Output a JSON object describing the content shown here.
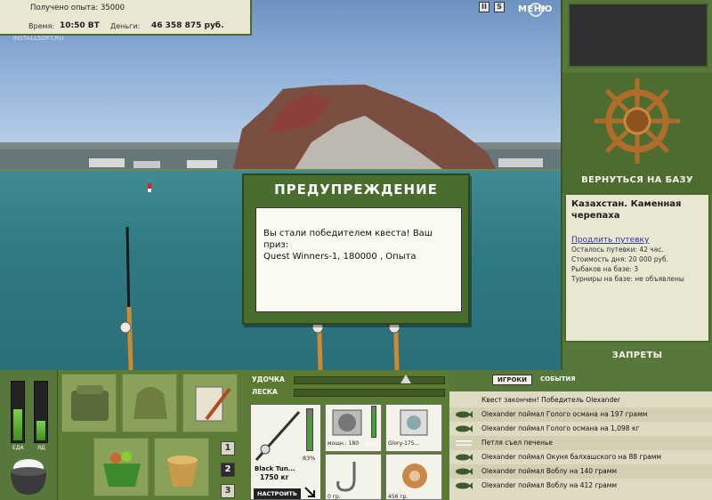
{
  "header": {
    "experience_label": "Получено опыта: 35000",
    "time_label": "Время:",
    "time_value": "10:50 ВТ",
    "money_label": "Деньги:",
    "money_value": "46 358 875 руб.",
    "watermark": "INSTALLSOFT.RU",
    "pause_icon_text": "II",
    "sound_icon_text": "S",
    "menu_label": "МЕНЮ"
  },
  "right_panel": {
    "return_label": "ВЕРНУТЬСЯ НА БАЗУ",
    "place_title": "Казахстан. Каменная черепаха",
    "extend_link": "Продлить путевку",
    "info_lines": [
      "Осталось путевки: 42 час.",
      "Стоимость дня: 20 000 руб.",
      "Рыбаков на базе: 3",
      "Турниры на базе: не объявлены"
    ],
    "bans_label": "ЗАПРЕТЫ"
  },
  "dialog": {
    "title": "ПРЕДУПРЕЖДЕНИЕ",
    "message_line1": "Вы стали победителем квеста! Ваш приз:",
    "message_line2": "Quest Winners-1, 180000 , Опыта"
  },
  "status": {
    "food_label": "ЕДА",
    "poison_label": "ЯД",
    "food_level": 0.55,
    "poison_level": 0.35
  },
  "inventory": {
    "tabs": [
      "1",
      "2",
      "3"
    ],
    "active_tab": 2
  },
  "tackle": {
    "rod_label": "УДОЧКА",
    "line_label": "ЛЕСКА",
    "rod_name": "Black Tun...",
    "rod_weight": "1750 кг",
    "rod_percent": "83%",
    "rod_level": 0.83,
    "setup_button": "НАСТРОИТЬ",
    "reel_caption": "мощн.: 180",
    "reel_percent": "86%",
    "reel_level": 0.86,
    "line_caption": "Glory-175...",
    "hook_caption": "0 гр.",
    "bait_caption": "456 гр."
  },
  "events": {
    "tab_players": "ИГРОКИ",
    "tab_events": "СОБЫТИЯ",
    "rows": [
      {
        "icon": "none",
        "text": "Квест закончен! Победитель Olexander"
      },
      {
        "icon": "fish-icon",
        "text": "Olexander поймал Голого османа на 197 грамм"
      },
      {
        "icon": "fish-icon",
        "text": "Olexander поймал Голого османа на 1,098 кг"
      },
      {
        "icon": "cutlery-icon",
        "text": "Петля съел печенье"
      },
      {
        "icon": "fish-icon",
        "text": "Olexander поймал Окуня балхашского на 88 грамм"
      },
      {
        "icon": "fish-icon",
        "text": "Olexander поймал Воблу на 140 грамм"
      },
      {
        "icon": "fish-icon",
        "text": "Olexander поймал Воблу на 412 грамм"
      }
    ]
  }
}
